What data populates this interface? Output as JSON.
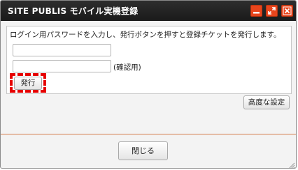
{
  "window": {
    "title": "SITE PUBLIS モバイル実機登録",
    "controls": [
      "minimize-icon",
      "maximize-icon",
      "close-icon"
    ],
    "accent_color": "#e8451c"
  },
  "form": {
    "instruction": "ログイン用パスワードを入力し、発行ボタンを押すと登録チケットを発行します。",
    "password_value": "",
    "password_confirm_value": "",
    "confirm_label": "(確認用)",
    "issue_button_label": "発行",
    "highlight_color": "#e60000"
  },
  "advanced_button_label": "高度な設定",
  "footer": {
    "close_button_label": "閉じる"
  }
}
